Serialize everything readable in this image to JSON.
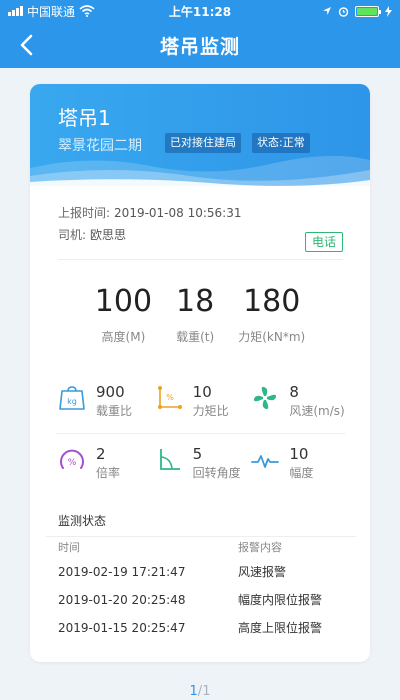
{
  "status_bar": {
    "carrier": "中国联通",
    "time": "上午11:28",
    "battery_color": "#5ee35e"
  },
  "nav": {
    "title": "塔吊监测",
    "back_icon": "chevron-left-icon"
  },
  "crane": {
    "name": "塔吊1",
    "project": "翠景花园二期",
    "tags": [
      "已对接住建局",
      "状态:正常"
    ]
  },
  "meta": {
    "report_label": "上报时间:",
    "report_time": "2019-01-08 10:56:31",
    "driver_label": "司机:",
    "driver_name": "欧思思",
    "phone_label": "电话"
  },
  "big_stats": [
    {
      "value": "100",
      "label": "高度(M)"
    },
    {
      "value": "18",
      "label": "载重(t)"
    },
    {
      "value": "180",
      "label": "力矩(kN*m)"
    }
  ],
  "metrics": [
    {
      "icon": "weight-kg-icon",
      "value": "900",
      "label": "载重比",
      "icon_text": "kg"
    },
    {
      "icon": "moment-percent-icon",
      "value": "10",
      "label": "力矩比",
      "icon_text": "%"
    },
    {
      "icon": "fan-icon",
      "value": "8",
      "label": "风速(m/s)"
    },
    {
      "icon": "gauge-percent-icon",
      "value": "2",
      "label": "倍率",
      "icon_text": "%"
    },
    {
      "icon": "angle-icon",
      "value": "5",
      "label": "回转角度"
    },
    {
      "icon": "pulse-icon",
      "value": "10",
      "label": "幅度"
    }
  ],
  "monitor": {
    "title": "监测状态",
    "headers": [
      "时间",
      "报警内容"
    ],
    "rows": [
      {
        "time": "2019-02-19 17:21:47",
        "alarm": "风速报警"
      },
      {
        "time": "2019-01-20 20:25:48",
        "alarm": "幅度内限位报警"
      },
      {
        "time": "2019-01-15 20:25:47",
        "alarm": "高度上限位报警"
      }
    ]
  },
  "pager": {
    "current": "1",
    "separator": "/",
    "total": "1"
  },
  "colors": {
    "primary": "#2b96ea",
    "phone_green": "#2eb872",
    "kg_icon": "#3a9ad9",
    "moment_icon": "#f0a020",
    "fan_icon": "#2cb88a",
    "gauge_icon": "#a050d0",
    "angle_icon": "#2cb88a",
    "pulse_icon": "#3a9ad9"
  }
}
